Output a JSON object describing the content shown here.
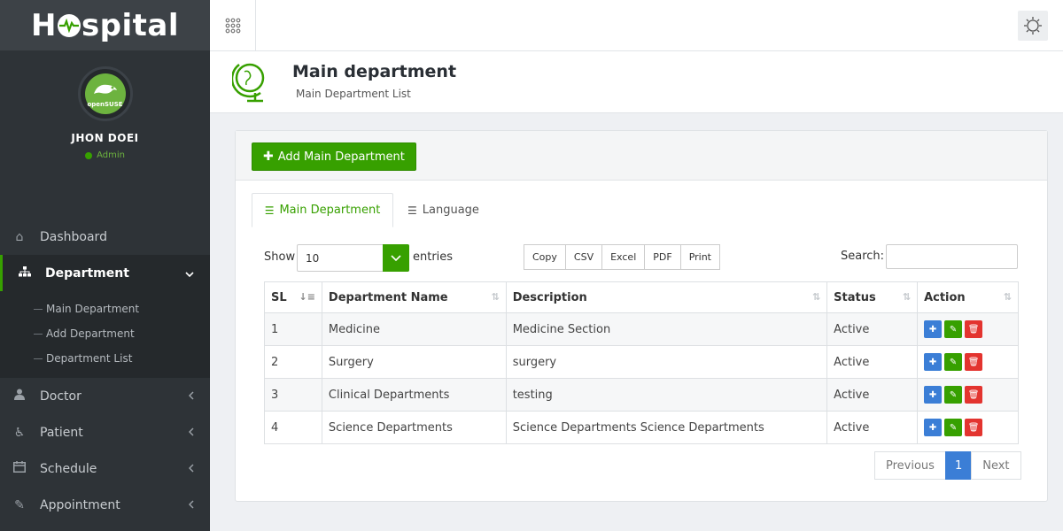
{
  "brand": {
    "name_pre": "H",
    "name_post": "spital"
  },
  "profile": {
    "name": "JHON DOEI",
    "role": "Admin",
    "avatar_text": "openSUSE"
  },
  "sidebar": {
    "items": [
      {
        "label": "Dashboard",
        "icon": "home-icon"
      },
      {
        "label": "Department",
        "icon": "sitemap-icon"
      },
      {
        "label": "Doctor",
        "icon": "user-md-icon"
      },
      {
        "label": "Patient",
        "icon": "wheelchair-icon"
      },
      {
        "label": "Schedule",
        "icon": "calendar-icon"
      },
      {
        "label": "Appointment",
        "icon": "edit-icon"
      }
    ],
    "submenu": [
      "Main Department",
      "Add Department",
      "Department List"
    ]
  },
  "header": {
    "title": "Main department",
    "subtitle": "Main Department List"
  },
  "panel": {
    "add_button": "Add Main Department"
  },
  "tabs": [
    "Main Department",
    "Language"
  ],
  "controls": {
    "show_label": "Show",
    "entries_value": "10",
    "entries_label": "entries",
    "export_buttons": [
      "Copy",
      "CSV",
      "Excel",
      "PDF",
      "Print"
    ],
    "search_label": "Search:"
  },
  "table": {
    "headers": [
      "SL",
      "Department Name",
      "Description",
      "Status",
      "Action"
    ],
    "rows": [
      {
        "sl": "1",
        "name": "Medicine",
        "description": "Medicine Section",
        "status": "Active"
      },
      {
        "sl": "2",
        "name": "Surgery",
        "description": "surgery",
        "status": "Active"
      },
      {
        "sl": "3",
        "name": "Clinical Departments",
        "description": "testing",
        "status": "Active"
      },
      {
        "sl": "4",
        "name": "Science Departments",
        "description": "Science Departments Science Departments",
        "status": "Active"
      }
    ]
  },
  "pagination": {
    "previous": "Previous",
    "current": "1",
    "next": "Next"
  },
  "colors": {
    "accent": "#37a000",
    "sidebar_bg": "#2e3337",
    "primary": "#3b7ed6",
    "danger": "#e3342f"
  }
}
